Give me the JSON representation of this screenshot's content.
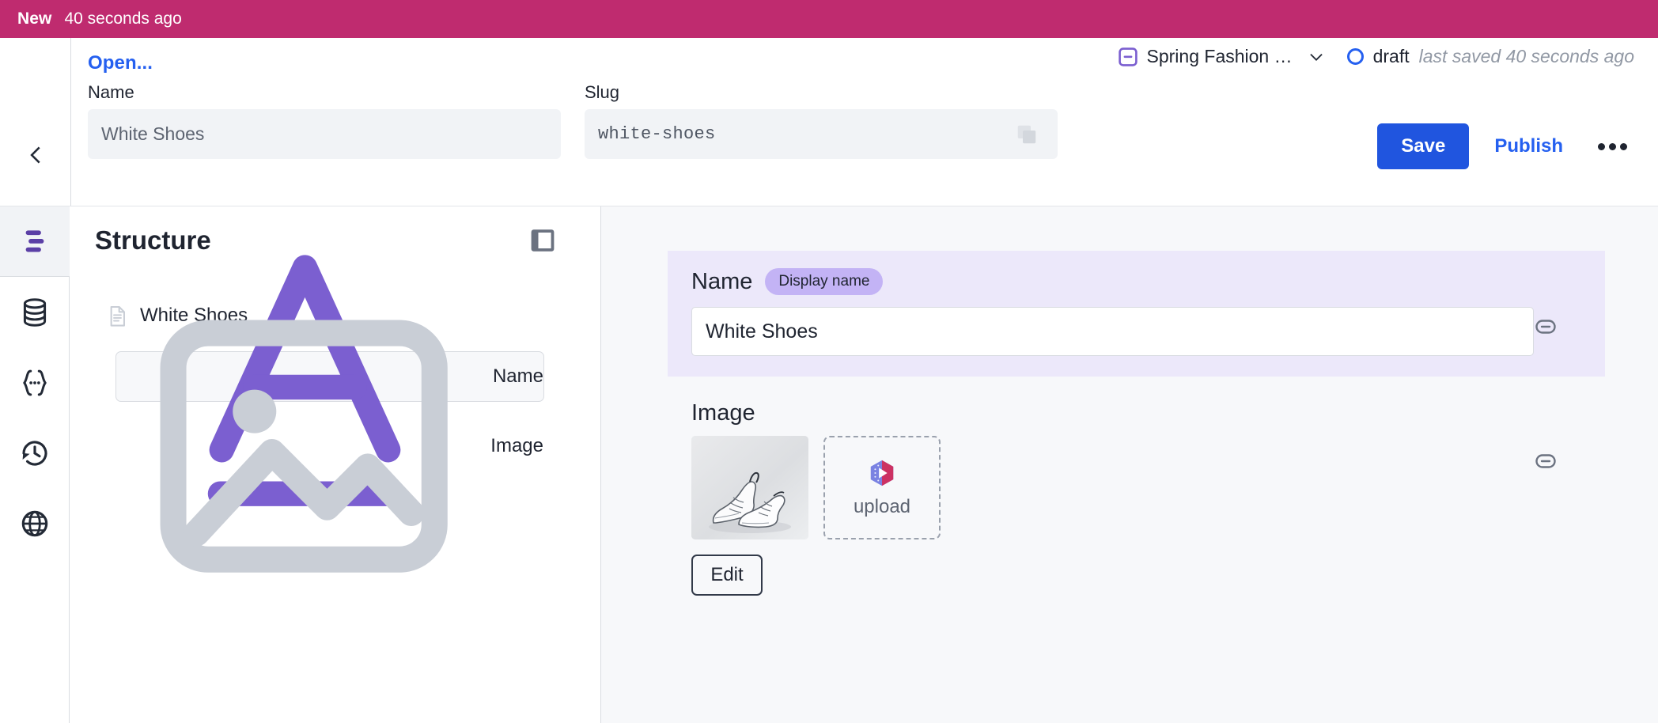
{
  "banner": {
    "status_label": "New",
    "timestamp": "40 seconds ago"
  },
  "header": {
    "open_link": "Open...",
    "name_label": "Name",
    "name_value": "White Shoes",
    "slug_label": "Slug",
    "slug_value": "white-shoes",
    "release_name": "Spring Fashion …",
    "doc_status": "draft",
    "saved_text": "last saved 40 seconds ago",
    "save_label": "Save",
    "publish_label": "Publish",
    "icons": {
      "back": "chevron-left-icon",
      "copy": "copy-icon",
      "release": "release-icon",
      "chevron": "chevron-down-icon",
      "status": "circle-outline-icon",
      "more": "more-options-icon"
    }
  },
  "rail": {
    "items": [
      {
        "icon": "structure-menu-icon",
        "name": "structure",
        "active": true
      },
      {
        "icon": "database-icon",
        "name": "content-lake",
        "active": false
      },
      {
        "icon": "json-braces-icon",
        "name": "inspect-json",
        "active": false
      },
      {
        "icon": "history-clock-icon",
        "name": "revision-history",
        "active": false
      },
      {
        "icon": "globe-icon",
        "name": "web-preview",
        "active": false
      }
    ]
  },
  "structure": {
    "title": "Structure",
    "toggle_icon": "panel-toggle-icon",
    "tree": {
      "root_label": "White Shoes",
      "root_icon": "document-icon",
      "children": [
        {
          "label": "Name",
          "icon": "text-field-icon",
          "selected": true
        },
        {
          "label": "Image",
          "icon": "image-field-icon",
          "selected": false
        }
      ]
    }
  },
  "form": {
    "name_field": {
      "label": "Name",
      "badge": "Display name",
      "value": "White Shoes",
      "marker_icon": "collapse-marker-icon"
    },
    "image_field": {
      "label": "Image",
      "thumbnail_alt": "white sneakers",
      "upload_label": "upload",
      "upload_icon": "uploadcare-logo-icon",
      "edit_label": "Edit",
      "marker_icon": "collapse-marker-icon"
    }
  },
  "colors": {
    "banner_pink": "#bf2b6f",
    "accent_blue": "#2055df",
    "link_blue": "#2560f0",
    "highlight_lavender": "#ece8fa",
    "badge_purple": "#c3b3f5",
    "rail_purple": "#5b3fa6",
    "panel_bg": "#f7f8fa"
  }
}
